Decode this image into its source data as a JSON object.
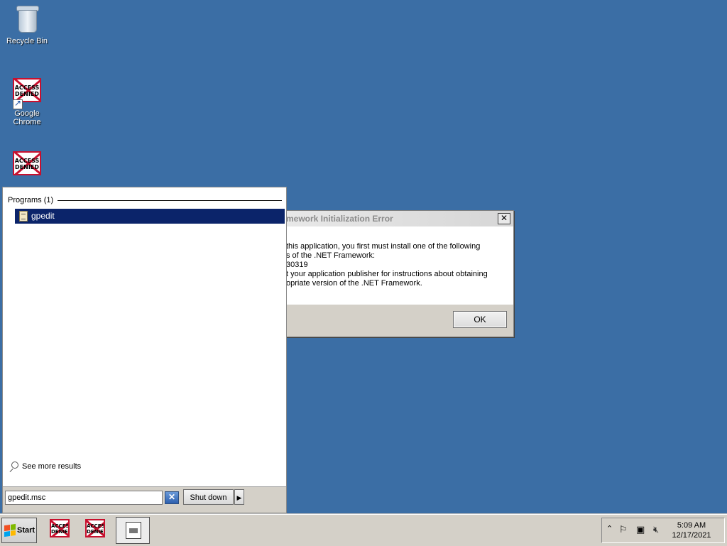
{
  "desktop": {
    "icons": [
      {
        "label": "Recycle Bin",
        "icon": "recycle-bin-icon"
      },
      {
        "label": "Google Chrome",
        "icon": "access-denied-icon",
        "badge": "ACCESS DENIED"
      },
      {
        "label": "",
        "icon": "access-denied-icon",
        "badge": "ACCESS DENIED"
      }
    ]
  },
  "dialog": {
    "title": "mework Initialization Error",
    "close": "✕",
    "message_lines": [
      " this application, you first must install one of the following",
      "s of the .NET Framework:",
      "30319",
      "t your application publisher for instructions about obtaining",
      "opriate version of the .NET Framework."
    ],
    "ok_label": "OK"
  },
  "start_menu": {
    "group_header": "Programs (1)",
    "result_label": "gpedit",
    "more_results": "See more results",
    "search_value": "gpedit.msc",
    "clear_icon": "✕",
    "shutdown_label": "Shut down",
    "shutdown_arrow": "▶"
  },
  "taskbar": {
    "start_label": "Start",
    "app_badge": "ACCESS DENIED",
    "clock_time": "5:09 AM",
    "clock_date": "12/17/2021",
    "tray_icons": [
      "show-hidden-icons-icon",
      "action-center-flag-icon",
      "network-icon",
      "volume-muted-icon"
    ]
  },
  "colors": {
    "desktop": "#3b6ea5",
    "selection": "#0b246a",
    "denied_red": "#c8102e"
  }
}
